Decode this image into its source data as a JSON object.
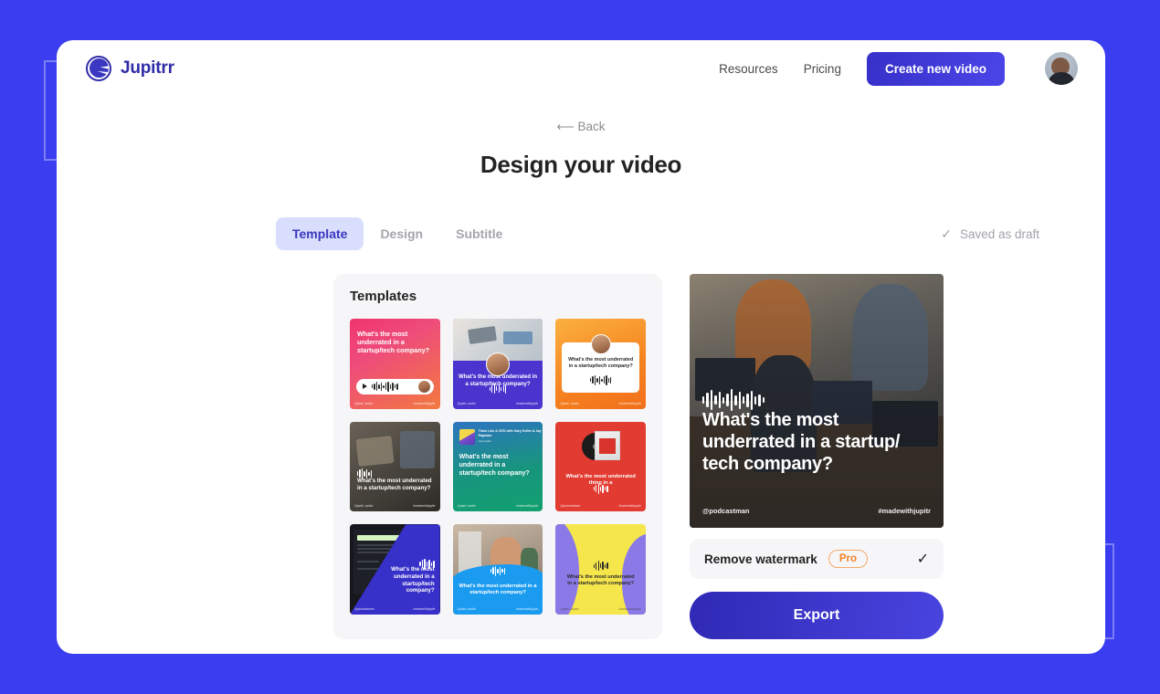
{
  "theme": {
    "page_background": "#3B3EF0",
    "brand_indigo": "#2F2CA8",
    "accent_pro": "#F08124",
    "tab_active_bg": "#D8DEFB"
  },
  "header": {
    "brand_name": "Jupitrr",
    "nav": [
      {
        "label": "Resources"
      },
      {
        "label": "Pricing"
      }
    ],
    "cta_label": "Create new video"
  },
  "back_label": "⟵ Back",
  "page_title": "Design your video",
  "tabs": [
    {
      "label": "Template",
      "active": true
    },
    {
      "label": "Design",
      "active": false
    },
    {
      "label": "Subtitle",
      "active": false
    }
  ],
  "save_status": {
    "icon": "check-icon",
    "text": "Saved as draft"
  },
  "templates_panel": {
    "title": "Templates",
    "items": [
      {
        "id": "template-1",
        "style": "pink-gradient-player",
        "text": "What's the most underrated in a startup/tech company?",
        "footer_left": "@patri_audio",
        "footer_right": "#madewithjupitr"
      },
      {
        "id": "template-2",
        "style": "purple-photo-avatar",
        "text": "What's the most underrated in a startup/tech company?",
        "footer_left": "@patri_audio",
        "footer_right": "#madewithjupitr"
      },
      {
        "id": "template-3",
        "style": "orange-white-card",
        "text": "What's the most underrated in a startup/tech company?",
        "footer_left": "@patri_audio",
        "footer_right": "#madewithjupitr"
      },
      {
        "id": "template-4",
        "style": "photo-overlay",
        "text": "What's the most underrated in a startup/tech company?",
        "footer_left": "@patri_audio",
        "footer_right": "#madewithjupitr"
      },
      {
        "id": "template-5",
        "style": "teal-gradient-album",
        "text": "What's the most underrated in a startup/tech company?",
        "album_title": "Think Like A CEO with Gary Keller & Jay Papasan",
        "album_subtitle": "Gary Keller",
        "footer_left": "@patri_audio",
        "footer_right": "#madewithjupitr"
      },
      {
        "id": "template-6",
        "style": "red-vinyl",
        "text": "What's the most underrated thing in a",
        "footer_left": "@podcastman",
        "footer_right": "#madewithjupitr"
      },
      {
        "id": "template-7",
        "style": "dark-screenshot-diagonal",
        "text": "What's the most underrated in a startup/tech company?",
        "footer_left": "@podcastman",
        "footer_right": "#madewithjupitr"
      },
      {
        "id": "template-8",
        "style": "photo-blue-wave",
        "text": "What's the most underrated in a startup/tech company?",
        "footer_left": "@patri_audio",
        "footer_right": "#madewithjupitr"
      },
      {
        "id": "template-9",
        "style": "yellow-purple-blob",
        "text": "What's the most underrated in a startup/tech company?",
        "footer_left": "@patri_audio",
        "footer_right": "#madewithjupitr"
      }
    ]
  },
  "preview": {
    "title": "What's the most underrated in a startup/ tech company?",
    "footer_left": "@podcastman",
    "footer_right": "#madewithjupitr"
  },
  "watermark": {
    "label": "Remove watermark",
    "badge": "Pro",
    "check_icon": "✓"
  },
  "export_button": "Export"
}
